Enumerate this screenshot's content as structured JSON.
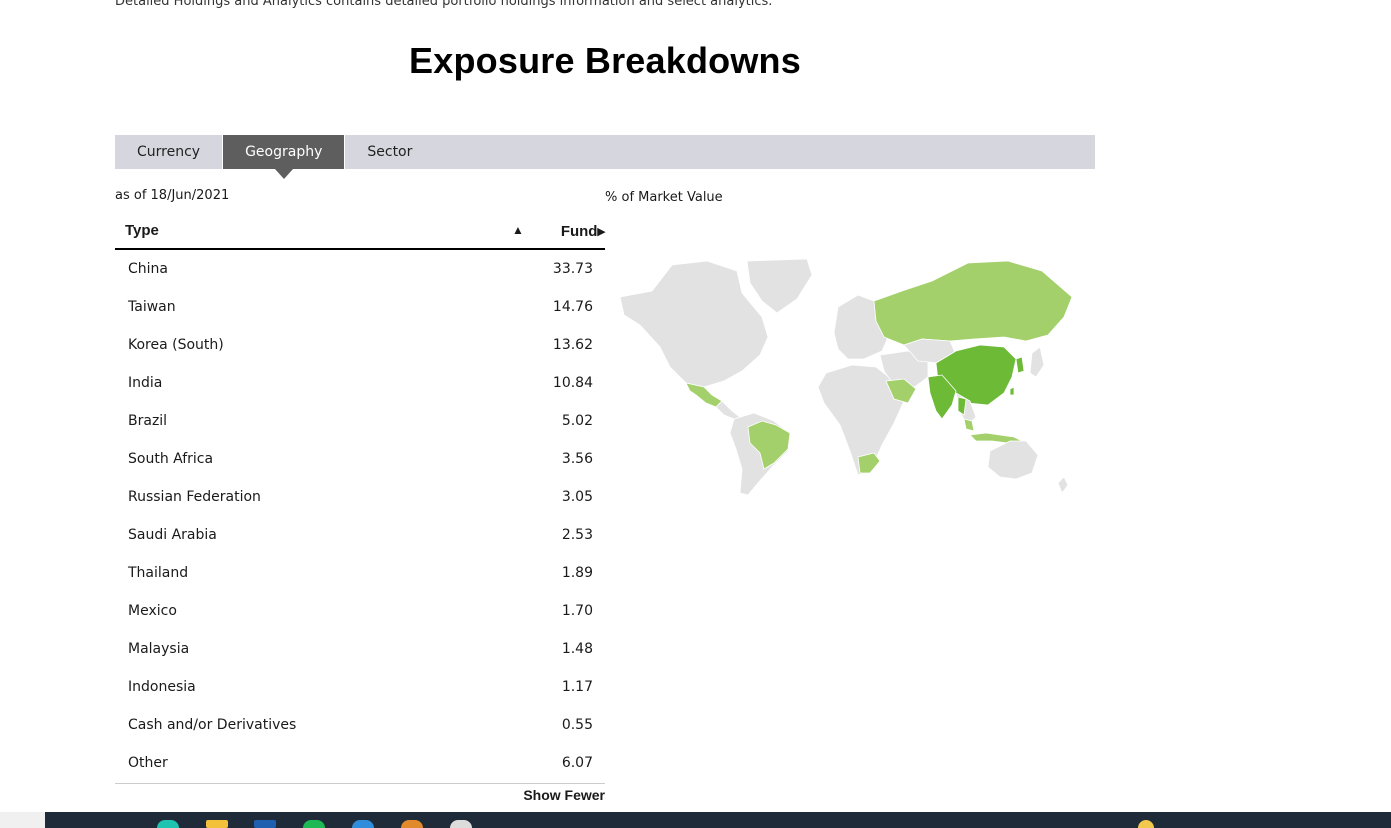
{
  "intro_text": "Detailed Holdings and Analytics contains detailed portfolio holdings information and select analytics.",
  "title": "Exposure Breakdowns",
  "tabs": [
    {
      "label": "Currency",
      "active": false
    },
    {
      "label": "Geography",
      "active": true
    },
    {
      "label": "Sector",
      "active": false
    }
  ],
  "as_of": "as of 18/Jun/2021",
  "chart_label": "% of Market Value",
  "table": {
    "col_type": "Type",
    "sort_icon": "▲",
    "col_fund": "Fund▸",
    "rows": [
      {
        "name": "China",
        "value": "33.73"
      },
      {
        "name": "Taiwan",
        "value": "14.76"
      },
      {
        "name": "Korea (South)",
        "value": "13.62"
      },
      {
        "name": "India",
        "value": "10.84"
      },
      {
        "name": "Brazil",
        "value": "5.02"
      },
      {
        "name": "South Africa",
        "value": "3.56"
      },
      {
        "name": "Russian Federation",
        "value": "3.05"
      },
      {
        "name": "Saudi Arabia",
        "value": "2.53"
      },
      {
        "name": "Thailand",
        "value": "1.89"
      },
      {
        "name": "Mexico",
        "value": "1.70"
      },
      {
        "name": "Malaysia",
        "value": "1.48"
      },
      {
        "name": "Indonesia",
        "value": "1.17"
      },
      {
        "name": "Cash and/or Derivatives",
        "value": "0.55"
      },
      {
        "name": "Other",
        "value": "6.07"
      }
    ],
    "show_fewer": "Show Fewer"
  },
  "map_colors": {
    "base": "#e2e2e2",
    "light": "#a3d06a",
    "dark": "#6cba35",
    "border": "#ffffff"
  }
}
